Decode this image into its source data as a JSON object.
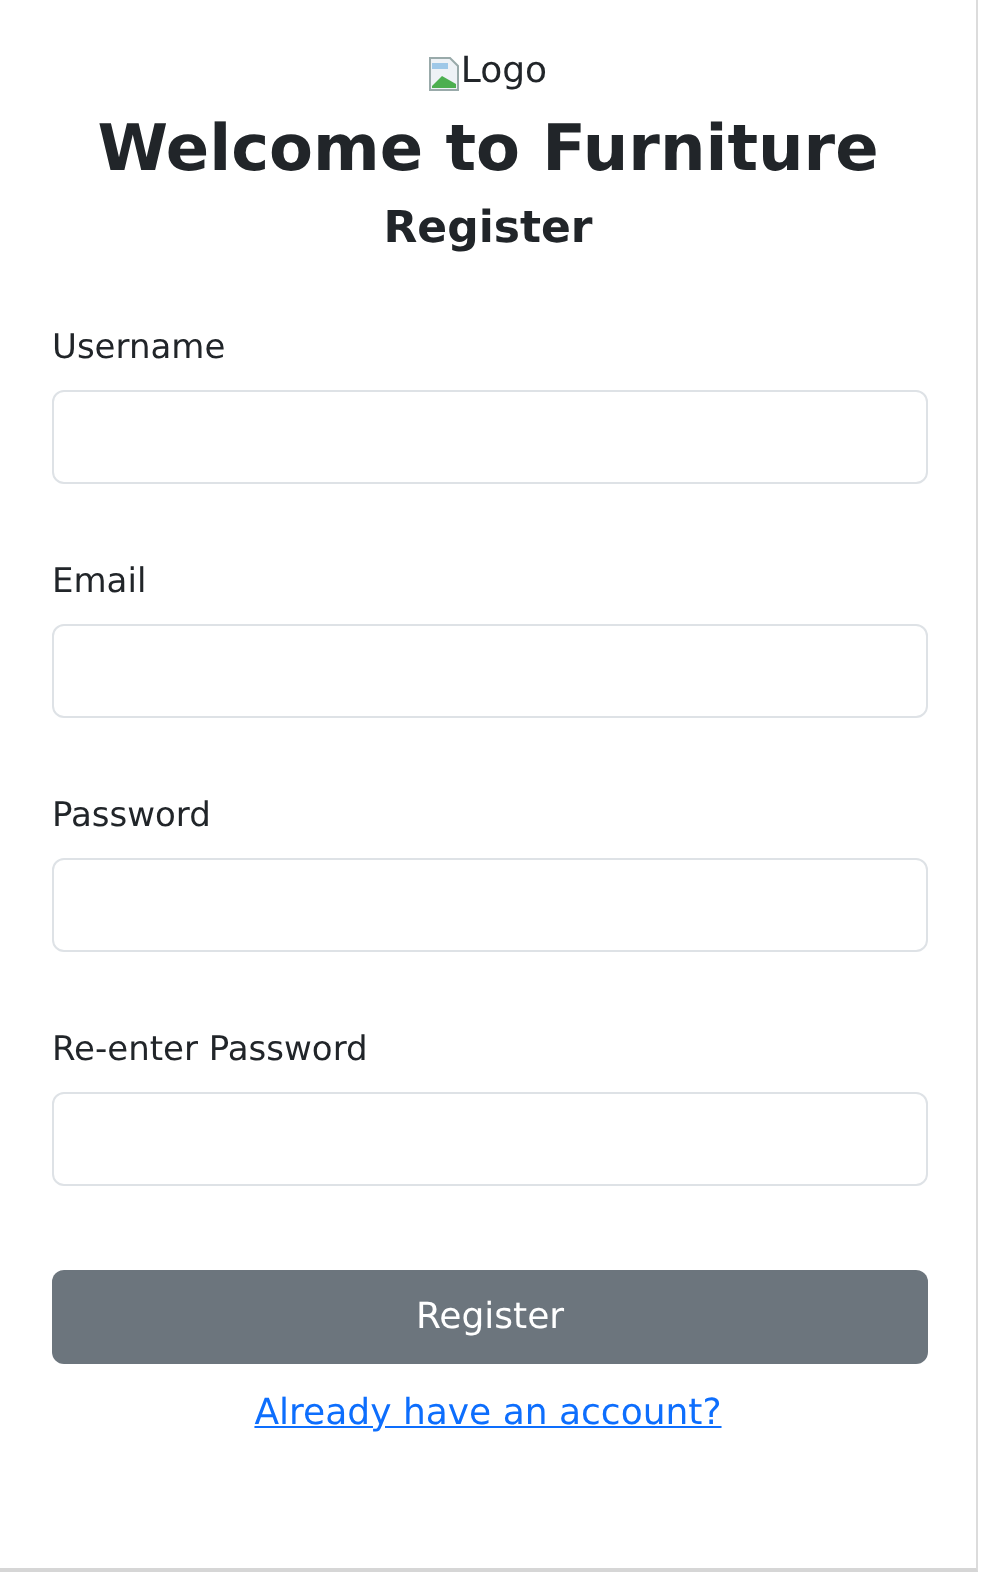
{
  "logo": {
    "alt": "Logo"
  },
  "title": "Welcome to Furniture",
  "subtitle": "Register",
  "fields": [
    {
      "label": "Username"
    },
    {
      "label": "Email"
    },
    {
      "label": "Password"
    },
    {
      "label": "Re-enter Password"
    }
  ],
  "submit_button": "Register",
  "login_link": "Already have an account?"
}
